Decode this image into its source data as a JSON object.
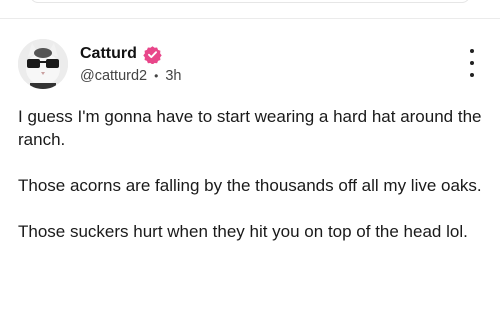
{
  "post": {
    "author": {
      "display_name": "Catturd",
      "handle": "@catturd2",
      "avatar": "cat-with-sunglasses-avatar",
      "verified_icon": "verified-badge-icon"
    },
    "separator": "•",
    "time_ago": "3h",
    "more_icon": "more-vertical-icon",
    "paragraphs": [
      "I guess I'm gonna have to start wearing a hard hat around the ranch.",
      "Those acorns are falling by the thousands off all my live oaks.",
      "Those suckers hurt when they hit you on top of the head lol."
    ]
  },
  "colors": {
    "verified": "#e8468a",
    "text": "#1a1a1a",
    "meta": "#444444",
    "border": "#ebebeb"
  }
}
